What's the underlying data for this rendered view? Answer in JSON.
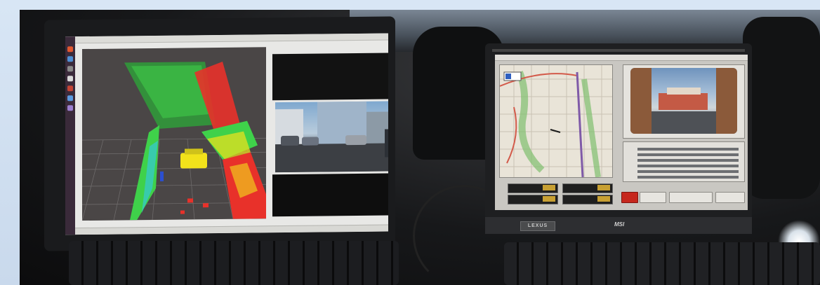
{
  "scene": {
    "description_visible_text": false
  },
  "laptop_right": {
    "brand_plate": "LEXUS",
    "brand_logo": "MSI"
  },
  "colors": {
    "lidar_green": "#3fd14a",
    "lidar_red": "#e8312a",
    "lidar_yellow": "#f2e21b",
    "lidar_cyan": "#36c9d6",
    "stop_button": "#c6271d",
    "readout_amber": "#c8a033"
  },
  "icons": {
    "dock": "app-launcher-icon",
    "stop": "stop-button"
  }
}
